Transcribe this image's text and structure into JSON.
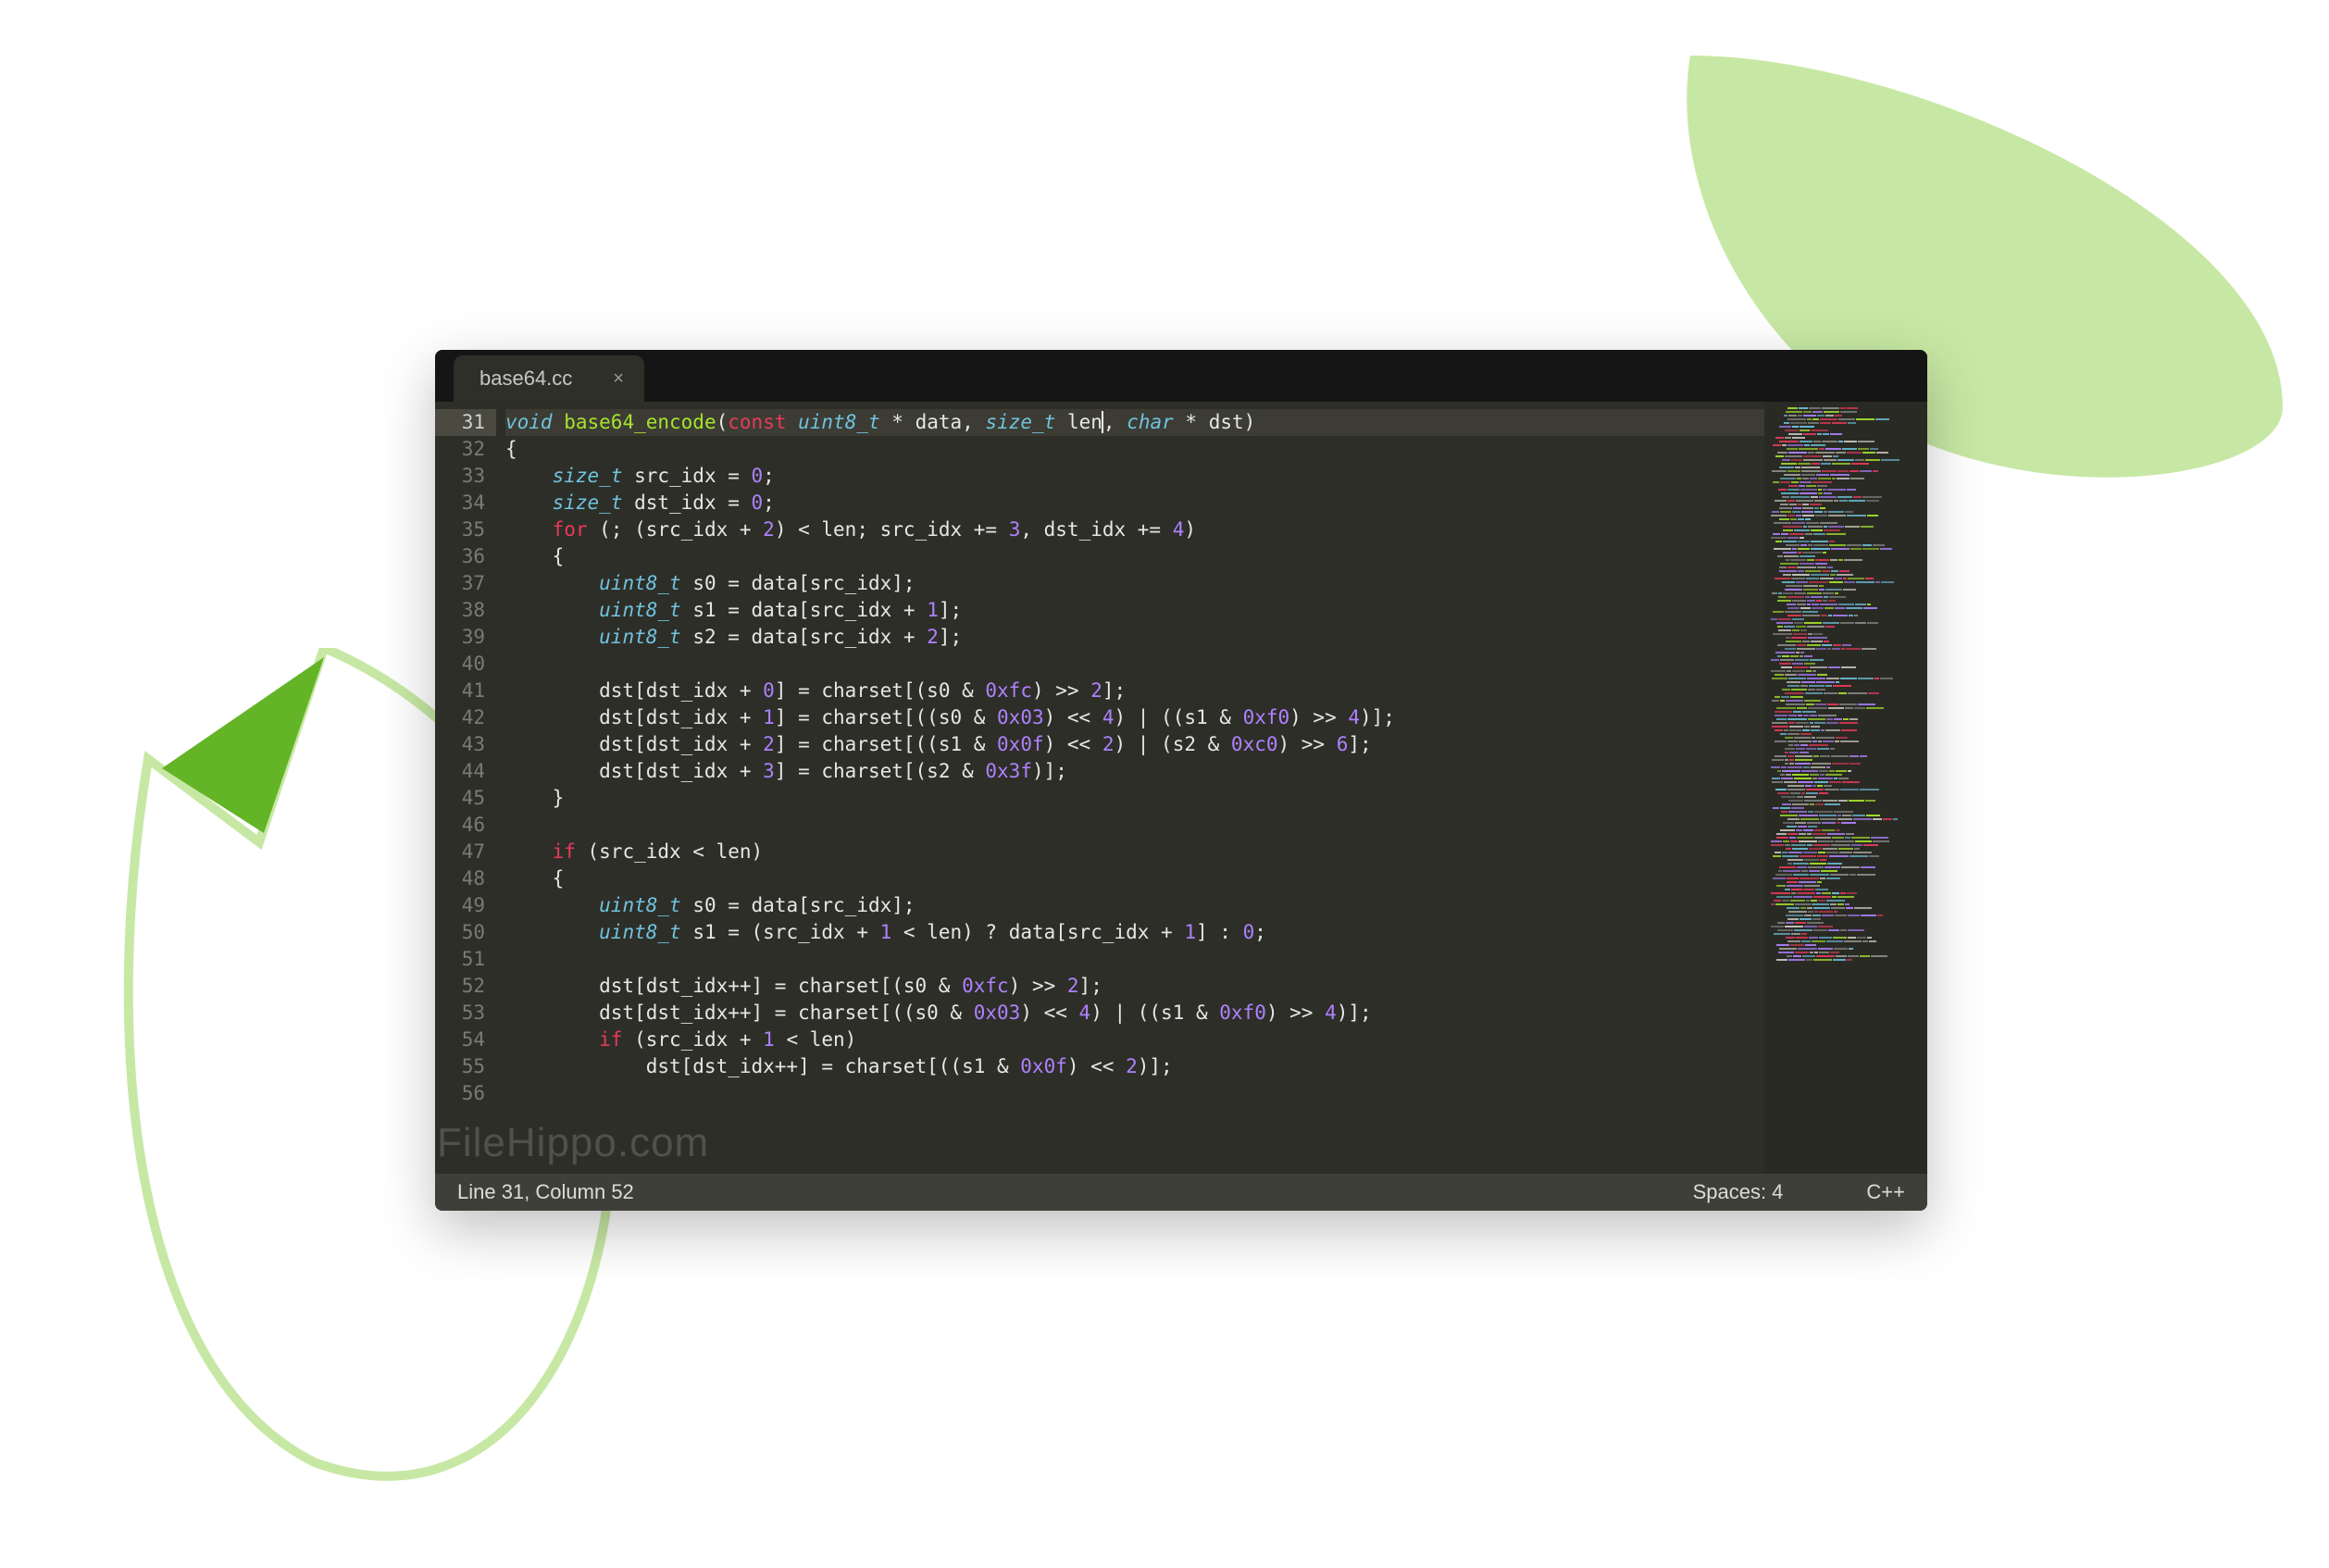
{
  "tab": {
    "title": "base64.cc",
    "close": "×"
  },
  "gutter": {
    "start": 31,
    "end": 56,
    "highlighted": 31
  },
  "code": {
    "lines": [
      {
        "n": 31,
        "hl": true,
        "tokens": [
          [
            "storage",
            "void"
          ],
          [
            "plain",
            " "
          ],
          [
            "fn",
            "base64_encode"
          ],
          [
            "plain",
            "("
          ],
          [
            "red",
            "const"
          ],
          [
            "plain",
            " "
          ],
          [
            "storage",
            "uint8_t"
          ],
          [
            "plain",
            " * data, "
          ],
          [
            "storage",
            "size_t"
          ],
          [
            "plain",
            " len"
          ],
          [
            "cursor",
            ""
          ],
          [
            "plain",
            ", "
          ],
          [
            "storage",
            "char"
          ],
          [
            "plain",
            " * dst)"
          ]
        ]
      },
      {
        "n": 32,
        "tokens": [
          [
            "plain",
            "{"
          ]
        ]
      },
      {
        "n": 33,
        "tokens": [
          [
            "plain",
            "    "
          ],
          [
            "storage",
            "size_t"
          ],
          [
            "plain",
            " src_idx = "
          ],
          [
            "num",
            "0"
          ],
          [
            "plain",
            ";"
          ]
        ]
      },
      {
        "n": 34,
        "tokens": [
          [
            "plain",
            "    "
          ],
          [
            "storage",
            "size_t"
          ],
          [
            "plain",
            " dst_idx = "
          ],
          [
            "num",
            "0"
          ],
          [
            "plain",
            ";"
          ]
        ]
      },
      {
        "n": 35,
        "tokens": [
          [
            "plain",
            "    "
          ],
          [
            "red",
            "for"
          ],
          [
            "plain",
            " (; (src_idx + "
          ],
          [
            "num",
            "2"
          ],
          [
            "plain",
            ") < len; src_idx += "
          ],
          [
            "num",
            "3"
          ],
          [
            "plain",
            ", dst_idx += "
          ],
          [
            "num",
            "4"
          ],
          [
            "plain",
            ")"
          ]
        ]
      },
      {
        "n": 36,
        "tokens": [
          [
            "plain",
            "    {"
          ]
        ]
      },
      {
        "n": 37,
        "tokens": [
          [
            "plain",
            "        "
          ],
          [
            "storage",
            "uint8_t"
          ],
          [
            "plain",
            " s0 = data[src_idx];"
          ]
        ]
      },
      {
        "n": 38,
        "tokens": [
          [
            "plain",
            "        "
          ],
          [
            "storage",
            "uint8_t"
          ],
          [
            "plain",
            " s1 = data[src_idx + "
          ],
          [
            "num",
            "1"
          ],
          [
            "plain",
            "];"
          ]
        ]
      },
      {
        "n": 39,
        "tokens": [
          [
            "plain",
            "        "
          ],
          [
            "storage",
            "uint8_t"
          ],
          [
            "plain",
            " s2 = data[src_idx + "
          ],
          [
            "num",
            "2"
          ],
          [
            "plain",
            "];"
          ]
        ]
      },
      {
        "n": 40,
        "tokens": [
          [
            "plain",
            ""
          ]
        ]
      },
      {
        "n": 41,
        "tokens": [
          [
            "plain",
            "        dst[dst_idx + "
          ],
          [
            "num",
            "0"
          ],
          [
            "plain",
            "] = charset[(s0 & "
          ],
          [
            "num",
            "0xfc"
          ],
          [
            "plain",
            ") >> "
          ],
          [
            "num",
            "2"
          ],
          [
            "plain",
            "];"
          ]
        ]
      },
      {
        "n": 42,
        "tokens": [
          [
            "plain",
            "        dst[dst_idx + "
          ],
          [
            "num",
            "1"
          ],
          [
            "plain",
            "] = charset[((s0 & "
          ],
          [
            "num",
            "0x03"
          ],
          [
            "plain",
            ") << "
          ],
          [
            "num",
            "4"
          ],
          [
            "plain",
            ") | ((s1 & "
          ],
          [
            "num",
            "0xf0"
          ],
          [
            "plain",
            ") >> "
          ],
          [
            "num",
            "4"
          ],
          [
            "plain",
            ")];"
          ]
        ]
      },
      {
        "n": 43,
        "tokens": [
          [
            "plain",
            "        dst[dst_idx + "
          ],
          [
            "num",
            "2"
          ],
          [
            "plain",
            "] = charset[((s1 & "
          ],
          [
            "num",
            "0x0f"
          ],
          [
            "plain",
            ") << "
          ],
          [
            "num",
            "2"
          ],
          [
            "plain",
            ") | (s2 & "
          ],
          [
            "num",
            "0xc0"
          ],
          [
            "plain",
            ") >> "
          ],
          [
            "num",
            "6"
          ],
          [
            "plain",
            "];"
          ]
        ]
      },
      {
        "n": 44,
        "tokens": [
          [
            "plain",
            "        dst[dst_idx + "
          ],
          [
            "num",
            "3"
          ],
          [
            "plain",
            "] = charset[(s2 & "
          ],
          [
            "num",
            "0x3f"
          ],
          [
            "plain",
            ")];"
          ]
        ]
      },
      {
        "n": 45,
        "tokens": [
          [
            "plain",
            "    }"
          ]
        ]
      },
      {
        "n": 46,
        "tokens": [
          [
            "plain",
            ""
          ]
        ]
      },
      {
        "n": 47,
        "tokens": [
          [
            "plain",
            "    "
          ],
          [
            "red",
            "if"
          ],
          [
            "plain",
            " (src_idx < len)"
          ]
        ]
      },
      {
        "n": 48,
        "tokens": [
          [
            "plain",
            "    {"
          ]
        ]
      },
      {
        "n": 49,
        "tokens": [
          [
            "plain",
            "        "
          ],
          [
            "storage",
            "uint8_t"
          ],
          [
            "plain",
            " s0 = data[src_idx];"
          ]
        ]
      },
      {
        "n": 50,
        "tokens": [
          [
            "plain",
            "        "
          ],
          [
            "storage",
            "uint8_t"
          ],
          [
            "plain",
            " s1 = (src_idx + "
          ],
          [
            "num",
            "1"
          ],
          [
            "plain",
            " < len) ? data[src_idx + "
          ],
          [
            "num",
            "1"
          ],
          [
            "plain",
            "] : "
          ],
          [
            "num",
            "0"
          ],
          [
            "plain",
            ";"
          ]
        ]
      },
      {
        "n": 51,
        "tokens": [
          [
            "plain",
            ""
          ]
        ]
      },
      {
        "n": 52,
        "tokens": [
          [
            "plain",
            "        dst[dst_idx++] = charset[(s0 & "
          ],
          [
            "num",
            "0xfc"
          ],
          [
            "plain",
            ") >> "
          ],
          [
            "num",
            "2"
          ],
          [
            "plain",
            "];"
          ]
        ]
      },
      {
        "n": 53,
        "tokens": [
          [
            "plain",
            "        dst[dst_idx++] = charset[((s0 & "
          ],
          [
            "num",
            "0x03"
          ],
          [
            "plain",
            ") << "
          ],
          [
            "num",
            "4"
          ],
          [
            "plain",
            ") | ((s1 & "
          ],
          [
            "num",
            "0xf0"
          ],
          [
            "plain",
            ") >> "
          ],
          [
            "num",
            "4"
          ],
          [
            "plain",
            ")];"
          ]
        ]
      },
      {
        "n": 54,
        "tokens": [
          [
            "plain",
            "        "
          ],
          [
            "red",
            "if"
          ],
          [
            "plain",
            " (src_idx + "
          ],
          [
            "num",
            "1"
          ],
          [
            "plain",
            " < len)"
          ]
        ]
      },
      {
        "n": 55,
        "tokens": [
          [
            "plain",
            "            dst[dst_idx++] = charset[((s1 & "
          ],
          [
            "num",
            "0x0f"
          ],
          [
            "plain",
            ") << "
          ],
          [
            "num",
            "2"
          ],
          [
            "plain",
            ")];"
          ]
        ]
      },
      {
        "n": 56,
        "tokens": [
          [
            "plain",
            ""
          ]
        ]
      }
    ]
  },
  "status": {
    "position": "Line 31, Column 52",
    "spaces": "Spaces: 4",
    "syntax": "C++"
  },
  "watermark": "FileHippo.com"
}
